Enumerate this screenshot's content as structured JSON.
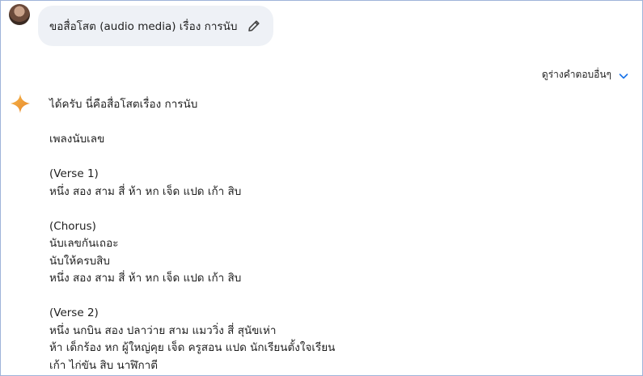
{
  "user_prompt": {
    "text": "ขอสื่อโสต (audio media) เรื่อง การนับ"
  },
  "drafts": {
    "label": "ดูร่างคำตอบอื่นๆ"
  },
  "response": {
    "intro": "ได้ครับ นี่คือสื่อโสตเรื่อง การนับ",
    "song_title": "เพลงนับเลข",
    "verse1_heading": "(Verse 1)",
    "verse1_line1": "หนึ่ง สอง สาม สี่ ห้า หก เจ็ด แปด เก้า สิบ",
    "chorus_heading": "(Chorus)",
    "chorus_line1": "นับเลขกันเถอะ",
    "chorus_line2": "นับให้ครบสิบ",
    "chorus_line3": "หนึ่ง สอง สาม สี่ ห้า หก เจ็ด แปด เก้า สิบ",
    "verse2_heading": "(Verse 2)",
    "verse2_line1": "หนึ่ง นกบิน สอง ปลาว่าย สาม แมววิ่ง สี่ สุนัขเห่า",
    "verse2_line2": "ห้า เด็กร้อง หก ผู้ใหญ่คุย เจ็ด ครูสอน แปด นักเรียนตั้งใจเรียน",
    "verse2_line3": "เก้า ไก่ขัน สิบ นาฬิกาตี"
  },
  "icons": {
    "edit": "pencil-icon",
    "drafts_toggle": "chevron-down-icon",
    "assistant": "sparkle-icon"
  },
  "colors": {
    "bubble_bg": "#eef1f6",
    "sparkle": "#f0a23a",
    "chevron": "#1a73e8"
  }
}
